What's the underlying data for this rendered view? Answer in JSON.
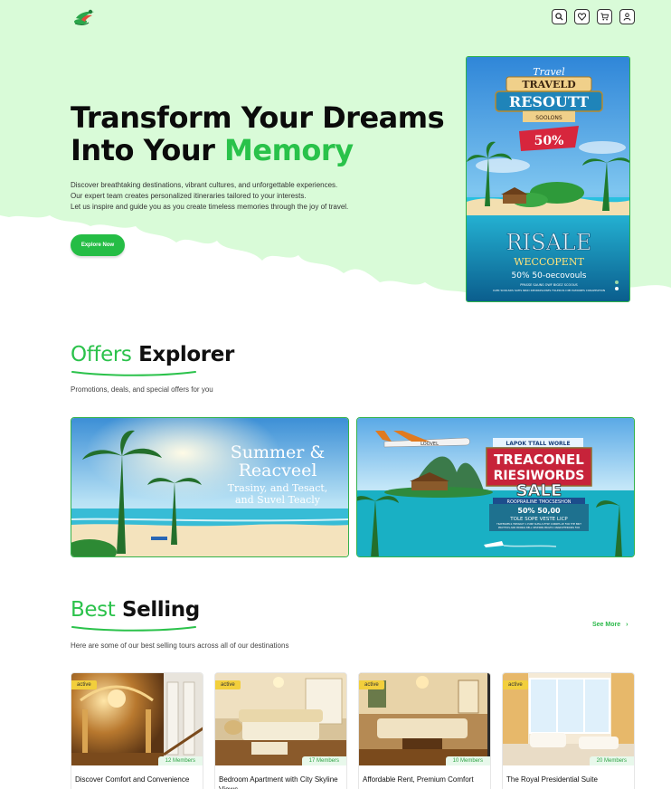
{
  "header": {
    "icons": [
      "search-icon",
      "heart-icon",
      "cart-icon",
      "user-icon"
    ]
  },
  "hero": {
    "title_line1": "Transform Your Dreams",
    "title_line2_prefix": "Into Your ",
    "title_line2_accent": "Memory",
    "desc_line1": "Discover breathtaking destinations, vibrant cultures, and unforgettable experiences.",
    "desc_line2": "Our expert team creates personalized itineraries tailored to your interests.",
    "desc_line3": "Let us inspire and guide you as you create timeless memories through the joy of travel.",
    "button": "Explore Now",
    "promo": {
      "script": "Travel",
      "banner1": "TRAVELD",
      "banner2": "RESOUTT",
      "banner3": "SOOLONS",
      "badge": "50%",
      "big": "RISALE",
      "sub": "WECCOPENT",
      "line": "50% 50-oecovouls",
      "small1": "PPASSE SAUNS OWF BIGEZ SCOOUS",
      "small2": "CLEK SOOLSDS SATIS NRID RPORKPLOISES FOLEDOS DIEI PAMORES CORAPEATION"
    }
  },
  "offers": {
    "title_accent": "Offers",
    "title_rest": " Explorer",
    "subtitle": "Promotions, deals, and special offers for you",
    "card1": {
      "line1": "Summer  &",
      "line2": "Reacveel",
      "line3": "Trasiny, and Tesact,",
      "line4": "and Suvel Teacly"
    },
    "card2": {
      "plane": "LOOVEL",
      "top": "LAPOK TTALL WORLE",
      "line1": "TREACONEL",
      "line2": "RIESIWORDS",
      "line3": "SALE",
      "strip": "ROOPRAILINE TMOCSESHON",
      "pct": "50% 50,00",
      "small1": "TOLE SOPE VESTE LICP",
      "small2": "TRATERWELS TREWAOT 1 PURE SUELLS ETSE CORNES AE FOR THE BRIT",
      "small3": "PROTTIOS AND BRINGS BELL SEVERIIN PRIGTIO 4NARVPTERIONS FOR"
    }
  },
  "best": {
    "title_accent": "Best",
    "title_rest": " Selling",
    "subtitle": "Here are some of our best selling tours across all of our destinations",
    "see_more": "See More",
    "cards": [
      {
        "tag": "active",
        "members": "12 Members",
        "title": "Discover Comfort and Convenience"
      },
      {
        "tag": "active",
        "members": "17 Members",
        "title": "Bedroom Apartment with City Skyline Views"
      },
      {
        "tag": "active",
        "members": "10 Members",
        "title": "Affordable Rent, Premium Comfort"
      },
      {
        "tag": "active",
        "members": "20 Members",
        "title": "The Royal Presidential Suite"
      }
    ]
  },
  "colors": {
    "accent": "#29c24a",
    "hero_bg": "#d9fbd8",
    "tag": "#f2cf3c"
  }
}
